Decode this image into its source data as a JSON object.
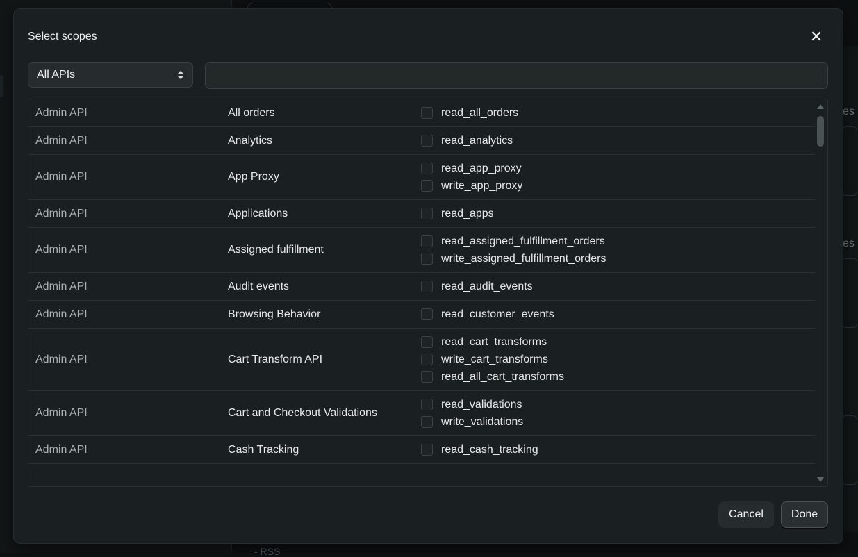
{
  "modal": {
    "title": "Select scopes",
    "close_icon": "close-icon",
    "api_filter": {
      "selected": "All APIs"
    },
    "search": {
      "value": "",
      "placeholder": ""
    }
  },
  "rows": [
    {
      "api": "Admin API",
      "name": "All orders",
      "scopes": [
        "read_all_orders"
      ]
    },
    {
      "api": "Admin API",
      "name": "Analytics",
      "scopes": [
        "read_analytics"
      ]
    },
    {
      "api": "Admin API",
      "name": "App Proxy",
      "scopes": [
        "read_app_proxy",
        "write_app_proxy"
      ]
    },
    {
      "api": "Admin API",
      "name": "Applications",
      "scopes": [
        "read_apps"
      ]
    },
    {
      "api": "Admin API",
      "name": "Assigned fulfillment",
      "scopes": [
        "read_assigned_fulfillment_orders",
        "write_assigned_fulfillment_orders"
      ]
    },
    {
      "api": "Admin API",
      "name": "Audit events",
      "scopes": [
        "read_audit_events"
      ]
    },
    {
      "api": "Admin API",
      "name": "Browsing Behavior",
      "scopes": [
        "read_customer_events"
      ]
    },
    {
      "api": "Admin API",
      "name": "Cart Transform API",
      "scopes": [
        "read_cart_transforms",
        "write_cart_transforms",
        "read_all_cart_transforms"
      ]
    },
    {
      "api": "Admin API",
      "name": "Cart and Checkout Validations",
      "scopes": [
        "read_validations",
        "write_validations"
      ]
    },
    {
      "api": "Admin API",
      "name": "Cash Tracking",
      "scopes": [
        "read_cash_tracking"
      ]
    }
  ],
  "footer": {
    "cancel_label": "Cancel",
    "done_label": "Done"
  },
  "background": {
    "side_text_1": "es",
    "side_text_2": "es",
    "bottom_text": "- RSS"
  }
}
